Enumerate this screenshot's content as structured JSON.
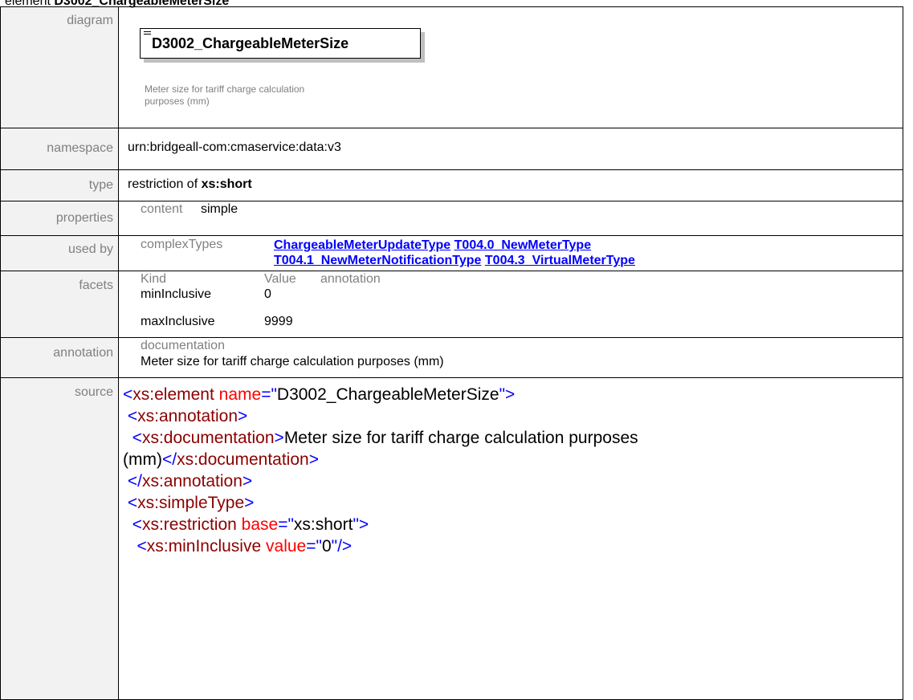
{
  "title": {
    "prefix": "element",
    "name": "D3002_ChargeableMeterSize"
  },
  "rows": {
    "diagram": {
      "label": "diagram",
      "box_text": "D3002_ChargeableMeterSize",
      "doc_line1": "Meter size for tariff charge calculation",
      "doc_line2": "purposes (mm)"
    },
    "namespace": {
      "label": "namespace",
      "value": "urn:bridgeall-com:cmaservice:data:v3"
    },
    "type": {
      "label": "type",
      "prefix": "restriction of",
      "value": "xs:short"
    },
    "properties": {
      "label": "properties",
      "key": "content",
      "value": "simple"
    },
    "used_by": {
      "label": "used by",
      "key": "complexTypes",
      "links": [
        "ChargeableMeterUpdateType",
        "T004.0_NewMeterType",
        "T004.1_NewMeterNotificationType",
        "T004.3_VirtualMeterType"
      ]
    },
    "facets": {
      "label": "facets",
      "headers": [
        "Kind",
        "Value",
        "annotation"
      ],
      "items": [
        {
          "kind": "minInclusive",
          "value": "0"
        },
        {
          "kind": "maxInclusive",
          "value": "9999"
        }
      ]
    },
    "annotation": {
      "label": "annotation",
      "key": "documentation",
      "value": "Meter size for tariff charge calculation purposes (mm)"
    },
    "source": {
      "label": "source",
      "element_name": "D3002_ChargeableMeterSize",
      "doc_text_1": "Meter size for tariff charge calculation purposes",
      "doc_text_2": "(mm)",
      "base": "xs:short",
      "min_value": "0"
    }
  }
}
